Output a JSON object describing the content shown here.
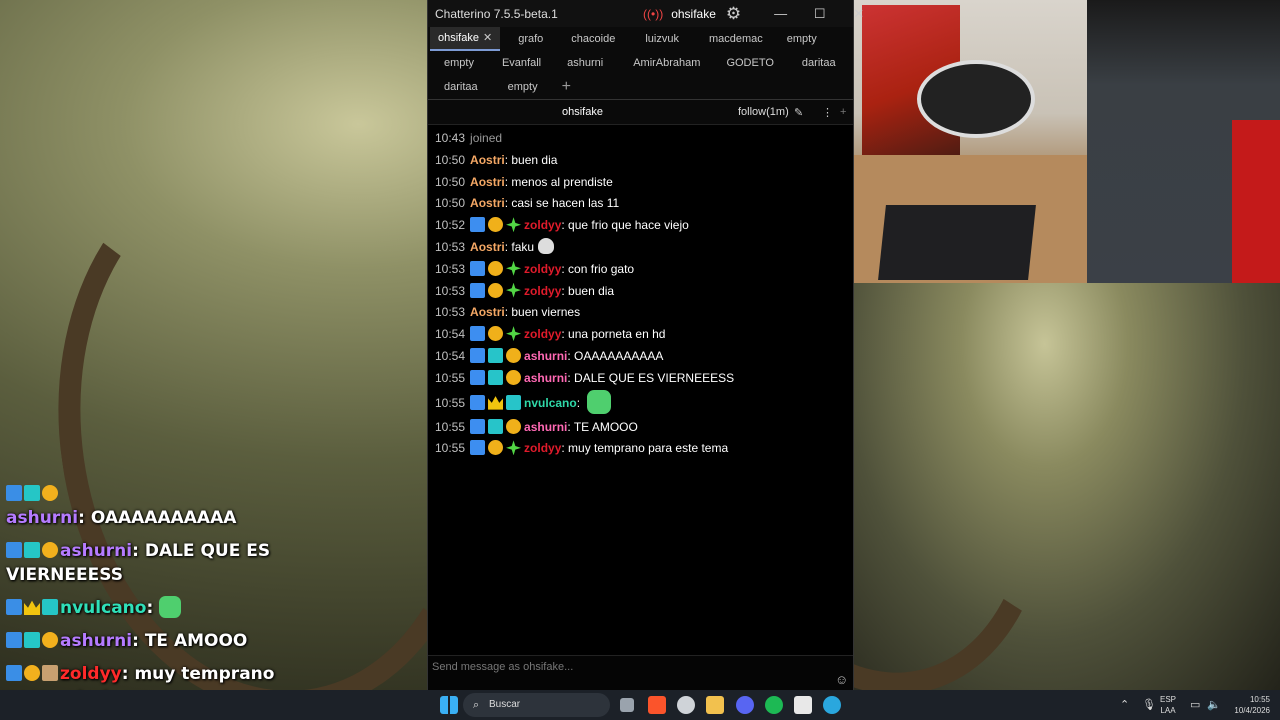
{
  "window": {
    "title": "Chatterino 7.5.5-beta.1",
    "account": "ohsifake",
    "controls": {
      "minimize": "—",
      "maximize": "☐",
      "close": "✕"
    }
  },
  "tabs": {
    "row1": [
      {
        "label": "ohsifake",
        "close": "✕",
        "active": true
      },
      {
        "label": "grafo"
      },
      {
        "label": "chacoide"
      },
      {
        "label": "luizvuk"
      },
      {
        "label": "macdemac"
      },
      {
        "label": "empty"
      }
    ],
    "row2": [
      {
        "label": "empty"
      },
      {
        "label": "Evanfall"
      },
      {
        "label": "ashurni"
      },
      {
        "label": "AmirAbraham"
      },
      {
        "label": "GODETO"
      },
      {
        "label": "daritaa"
      }
    ],
    "row3": [
      {
        "label": "daritaa"
      },
      {
        "label": "empty"
      }
    ],
    "add_tab": "+"
  },
  "channel_bar": {
    "channel": "ohsifake",
    "follow_mode": "follow(1m)",
    "pencil": "✎",
    "menu": "⋮",
    "add": "+"
  },
  "messages": [
    {
      "time": "10:43",
      "system": "joined"
    },
    {
      "time": "10:50",
      "user": "Aostri",
      "text": "buen dia",
      "badges": []
    },
    {
      "time": "10:50",
      "user": "Aostri",
      "text": "menos al prendiste",
      "badges": []
    },
    {
      "time": "10:50",
      "user": "Aostri",
      "text": "casi se hacen las 11",
      "badges": []
    },
    {
      "time": "10:52",
      "user": "zoldyy",
      "text": "que frio que hace viejo",
      "badges": [
        "sword",
        "coin",
        "star"
      ]
    },
    {
      "time": "10:53",
      "user": "Aostri",
      "text": "faku",
      "badges": [],
      "emote": true
    },
    {
      "time": "10:53",
      "user": "zoldyy",
      "text": "con frio gato",
      "badges": [
        "sword",
        "coin",
        "star"
      ]
    },
    {
      "time": "10:53",
      "user": "zoldyy",
      "text": "buen dia",
      "badges": [
        "sword",
        "coin",
        "star"
      ]
    },
    {
      "time": "10:53",
      "user": "Aostri",
      "text": "buen viernes",
      "badges": []
    },
    {
      "time": "10:54",
      "user": "zoldyy",
      "text": "una porneta en hd",
      "badges": [
        "sword",
        "coin",
        "star"
      ]
    },
    {
      "time": "10:54",
      "user": "ashurni",
      "text": "OAAAAAAAAAA",
      "badges": [
        "sword",
        "gg",
        "coin"
      ]
    },
    {
      "time": "10:55",
      "user": "ashurni",
      "text": "DALE QUE ES VIERNEEESS",
      "badges": [
        "sword",
        "gg",
        "coin"
      ]
    },
    {
      "time": "10:55",
      "user": "nvulcano",
      "text": "",
      "badges": [
        "sword",
        "crown",
        "gg"
      ],
      "emote": true
    },
    {
      "time": "10:55",
      "user": "ashurni",
      "text": "TE AMOOO",
      "badges": [
        "sword",
        "gg",
        "coin"
      ]
    },
    {
      "time": "10:55",
      "user": "zoldyy",
      "text": "muy temprano para este tema",
      "badges": [
        "sword",
        "coin",
        "star"
      ]
    }
  ],
  "input": {
    "placeholder": "Send message as ohsifake...",
    "emoji_icon": "☺"
  },
  "overlay": {
    "messages": [
      {
        "user": "ashurni",
        "text": "OAAAAAAAAAA"
      },
      {
        "user": "ashurni",
        "text": "DALE QUE ES VIERNEEESS"
      },
      {
        "user": "nvulcano",
        "text": ""
      },
      {
        "user": "ashurni",
        "text": "TE AMOOO"
      },
      {
        "user": "zoldyy",
        "text": "muy temprano para este tema"
      }
    ]
  },
  "taskbar": {
    "search_label": "Buscar",
    "lang_top": "ESP",
    "lang_bottom": "LAA",
    "time": "10:55",
    "date": "10/4/2026"
  },
  "colors": {
    "aostri": "#f5a865",
    "zoldyy": "#e01b2b",
    "ashurni": "#ff69b4",
    "nvulcano": "#2fd8a8",
    "active_tab_underline": "#7d9bd4"
  }
}
